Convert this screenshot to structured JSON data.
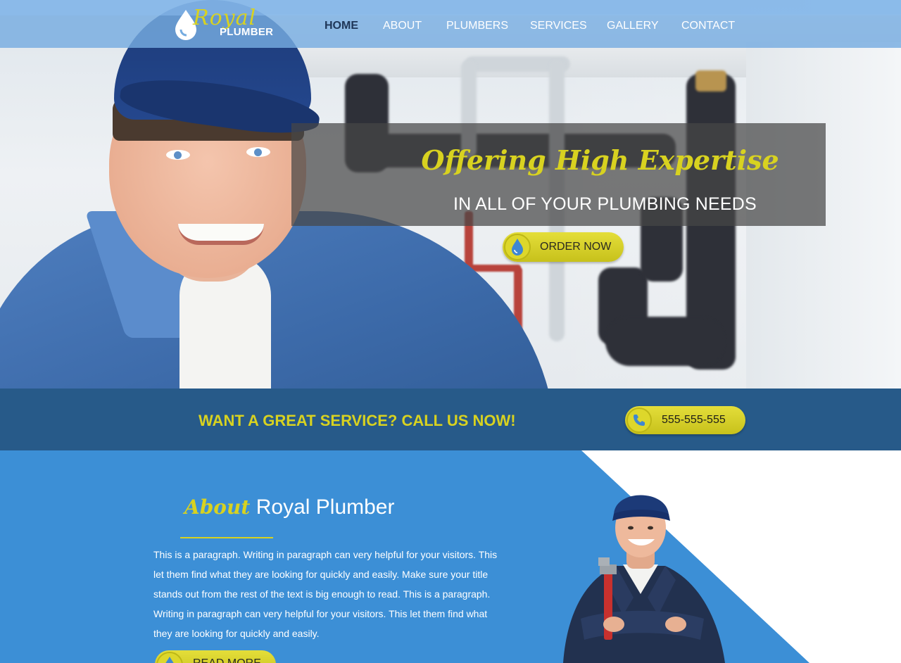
{
  "brand": {
    "script": "Royal",
    "word": "PLUMBER"
  },
  "nav": {
    "items": [
      {
        "label": "HOME",
        "active": true
      },
      {
        "label": "ABOUT",
        "active": false
      },
      {
        "label": "PLUMBERS",
        "active": false
      },
      {
        "label": "SERVICES",
        "active": false
      },
      {
        "label": "GALLERY",
        "active": false
      },
      {
        "label": "CONTACT",
        "active": false
      }
    ]
  },
  "hero": {
    "headline": "Offering High Expertise",
    "subheadline": "IN  ALL OF YOUR PLUMBING NEEDS",
    "cta_label": "ORDER NOW",
    "cta_icon": "water-drop-icon"
  },
  "call_strip": {
    "text": "WANT A GREAT SERVICE? CALL US NOW!",
    "phone": "555-555-555",
    "phone_icon": "phone-icon"
  },
  "about": {
    "script": "About",
    "name": "Royal Plumber",
    "paragraph": "This is a paragraph. Writing in paragraph can very helpful for your visitors. This let them find what they are looking for quickly and easily. Make sure your title stands out from the rest of the text is big enough to read. This is a paragraph. Writing in paragraph can very helpful for your visitors. This let them find what they are looking for quickly and easily.",
    "read_more_label": "READ MORE"
  },
  "colors": {
    "accent_yellow": "#d8d220",
    "nav_blue": "#76ace0",
    "strip_blue": "#275a89",
    "about_blue": "#3c8fd6",
    "active_nav": "#1f3658"
  }
}
